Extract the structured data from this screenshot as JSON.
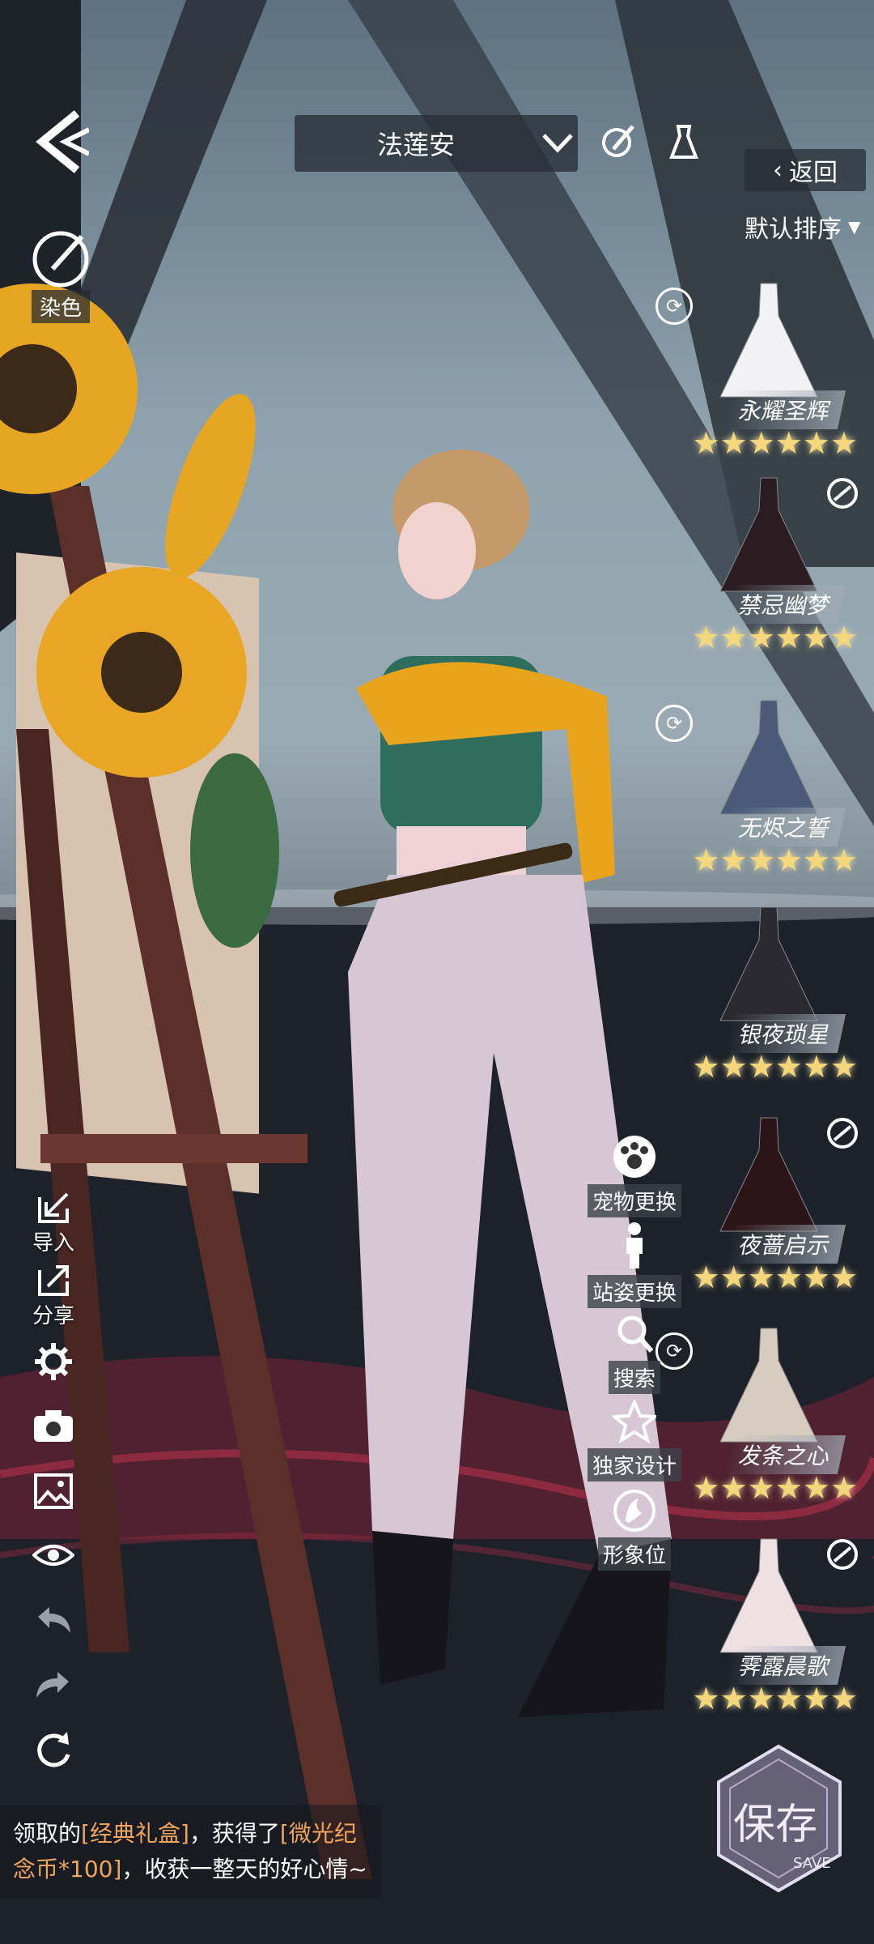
{
  "header": {
    "character_name": "法莲安",
    "back_label": "返回",
    "sort_label": "默认排序"
  },
  "left_panel": {
    "dye_label": "染色",
    "import_label": "导入",
    "share_label": "分享"
  },
  "outfits": [
    {
      "name": "永耀圣辉",
      "stars": 6,
      "badge": "swap"
    },
    {
      "name": "禁忌幽梦",
      "stars": 6,
      "badge": "ban"
    },
    {
      "name": "无烬之誓",
      "stars": 6,
      "badge": "swap"
    },
    {
      "name": "银夜琐星",
      "stars": 6,
      "badge": "none"
    },
    {
      "name": "夜蔷启示",
      "stars": 6,
      "badge": "ban"
    },
    {
      "name": "发条之心",
      "stars": 6,
      "badge": "swap"
    },
    {
      "name": "霁露晨歌",
      "stars": 6,
      "badge": "ban"
    }
  ],
  "mid_actions": {
    "pet_label": "宠物更换",
    "pose_label": "站姿更换",
    "search_label": "搜索",
    "exclusive_label": "独家设计",
    "image_label": "形象位"
  },
  "message": {
    "prefix": "领取的",
    "item1": "[经典礼盒]",
    "middle": "，获得了",
    "item2": "[微光纪念币*100]",
    "suffix": "，收获一整天的好心情~"
  },
  "save": {
    "label": "保存",
    "sub": "SAVE"
  },
  "colors": {
    "star": "#f3d77a",
    "highlight": "#f0a55a"
  }
}
